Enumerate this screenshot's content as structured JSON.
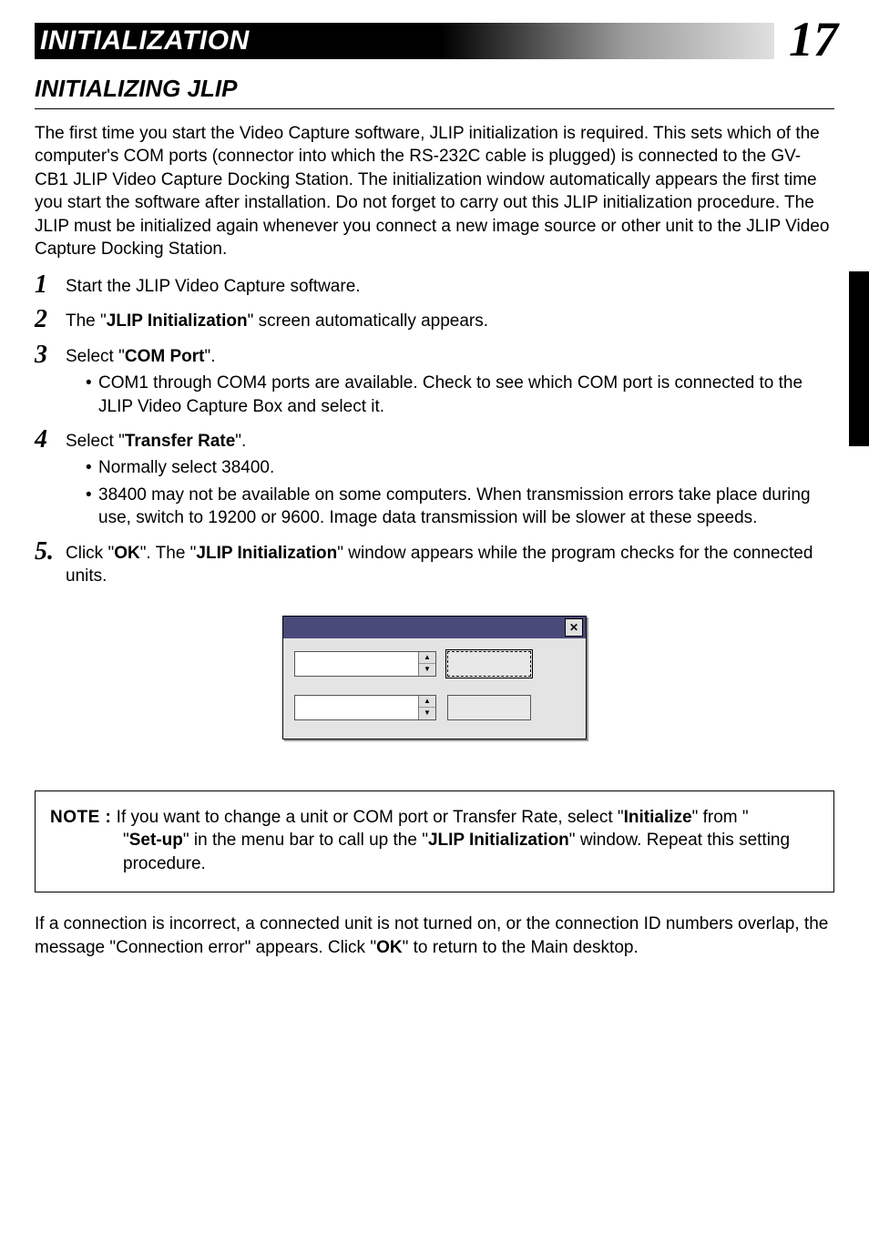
{
  "page_number": "17",
  "header": {
    "title": "INITIALIZATION",
    "subtitle": "INITIALIZING  JLIP"
  },
  "intro": "The first time you start the Video Capture software, JLIP initialization is required. This sets which of the computer's  COM ports (connector into which the RS-232C cable is plugged) is connected to the GV-CB1 JLIP Video Capture Docking Station.  The initialization window automatically appears the first time you start the software after installation. Do not forget to carry out this JLIP initialization procedure.  The JLIP must be initialized again whenever you connect a new image source or other unit to the JLIP Video Capture Docking Station.",
  "steps": {
    "s1": {
      "num": "1",
      "text_a": "Start the JLIP Video Capture software."
    },
    "s2": {
      "num": "2",
      "text_a": "The \"",
      "bold_a": "JLIP Initialization",
      "text_b": "\" screen automatically appears."
    },
    "s3": {
      "num": "3",
      "text_a": "Select \"",
      "bold_a": "COM Port",
      "text_b": "\".",
      "bullets": {
        "b1": "COM1 through COM4 ports are available. Check to see which COM port is connected to the JLIP Video Capture Box and select it."
      }
    },
    "s4": {
      "num": "4",
      "text_a": "Select \"",
      "bold_a": "Transfer Rate",
      "text_b": "\".",
      "bullets": {
        "b1": "Normally select 38400.",
        "b2": "38400 may not be available on some computers.  When transmission errors take place during use, switch to 19200 or 9600.  Image data transmission will be slower at these speeds."
      }
    },
    "s5": {
      "num": "5.",
      "text_a": "Click \"",
      "bold_a": "OK",
      "text_b": "\". The \"",
      "bold_b": "JLIP Initialization",
      "text_c": "\" window appears while the program checks for the connected units."
    }
  },
  "dialog": {
    "close_glyph": "✕",
    "up_glyph": "▲",
    "down_glyph": "▼"
  },
  "note": {
    "label": "NOTE :",
    "t1": " If you want to change a unit or COM port or Transfer Rate, select \"",
    "b1": "Initialize",
    "t2": "\" from \"",
    "b2": "Set-up",
    "t3": "\" in the menu bar to call up the \"",
    "b3": "JLIP Initialization",
    "t4": "\" window. Repeat this setting procedure."
  },
  "footer": {
    "t1": "If a connection is incorrect, a connected unit is not turned on, or the connection ID numbers overlap, the message \"Connection error\" appears.  Click \"",
    "b1": "OK",
    "t2": "\" to return to the Main desktop."
  }
}
